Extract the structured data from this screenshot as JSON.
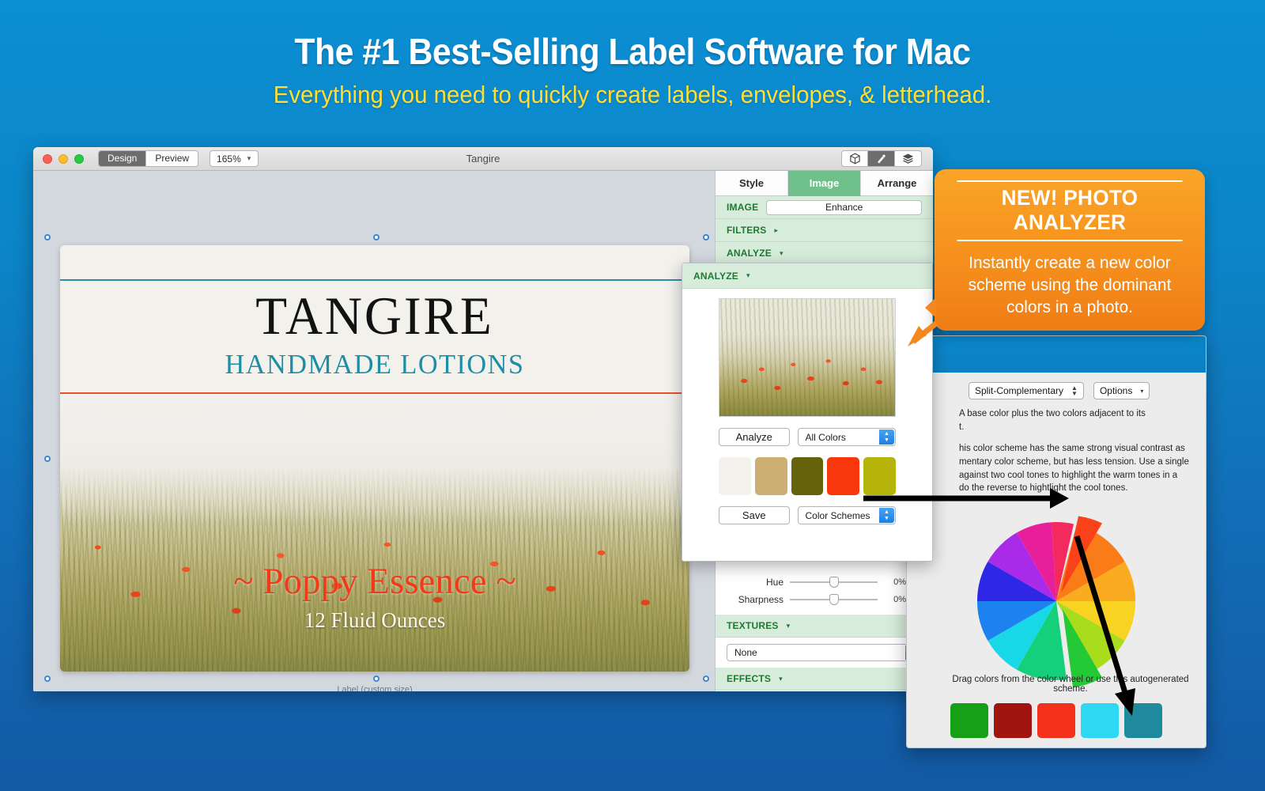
{
  "promo": {
    "title": "The #1 Best-Selling Label Software for Mac",
    "subtitle": "Everything you need to quickly create labels, envelopes, & letterhead.",
    "title_color": "#ffffff",
    "subtitle_color": "#ffdd33",
    "background_top": "#0b8ed2",
    "background_bottom": "#1359a4"
  },
  "window": {
    "title": "Tangire",
    "view_modes": {
      "design": "Design",
      "preview": "Preview",
      "active": "Design"
    },
    "zoom": {
      "value": "165%",
      "caret": "chevron-down-icon"
    },
    "toolbar_icons": [
      {
        "name": "box-icon",
        "active": false
      },
      {
        "name": "paint-inspector-icon",
        "active": true
      },
      {
        "name": "layers-icon",
        "active": false
      }
    ],
    "status": "Label (custom size)"
  },
  "label": {
    "brand": "TANGIRE",
    "brand_color": "#121212",
    "tagline": "HANDMADE LOTIONS",
    "tagline_color": "#1d8ea6",
    "rule_top_color": "#2b8fa3",
    "rule_bottom_color": "#e8502a",
    "flavor": "~ Poppy Essence ~",
    "flavor_color": "#f03a18",
    "volume": "12 Fluid Ounces",
    "volume_color": "#fbf8f0"
  },
  "inspector": {
    "tabs": [
      {
        "label": "Style",
        "active": false
      },
      {
        "label": "Image",
        "active": true
      },
      {
        "label": "Arrange",
        "active": false
      }
    ],
    "accent": "#6fc08a",
    "header_bg": "#d7ecda",
    "header_text": "#1d7a30",
    "sections": {
      "image": {
        "title": "IMAGE",
        "button": "Enhance"
      },
      "filters": {
        "title": "FILTERS",
        "arrow": "▸"
      },
      "analyze": {
        "title": "ANALYZE",
        "arrow": "▾"
      },
      "textures": {
        "title": "TEXTURES",
        "arrow": "▾",
        "value": "None"
      },
      "effects": {
        "title": "EFFECTS",
        "arrow": "▾"
      }
    },
    "sliders": [
      {
        "label": "Hue",
        "value": "0%"
      },
      {
        "label": "Sharpness",
        "value": "0%"
      }
    ]
  },
  "analyze_popover": {
    "title": "ANALYZE",
    "arrow": "▾",
    "analyze_button": "Analyze",
    "filter_dropdown": "All Colors",
    "save_button": "Save",
    "schemes_dropdown": "Color Schemes",
    "swatches": [
      {
        "name": "off-white",
        "hex": "#f4f2ed"
      },
      {
        "name": "tan",
        "hex": "#cdae73"
      },
      {
        "name": "olive",
        "hex": "#64630c"
      },
      {
        "name": "orange-red",
        "hex": "#f8380c"
      },
      {
        "name": "yellow-olive",
        "hex": "#b6b40a"
      }
    ]
  },
  "callout": {
    "title": "NEW! PHOTO ANALYZER",
    "body": "Instantly create a new color scheme using the dominant colors in a photo.",
    "bg_top": "#f9a528",
    "bg_bottom": "#f07d15"
  },
  "color_scheme_window": {
    "scheme_type": "Split-Complementary",
    "options_label": "Options",
    "description_1": "A base color plus the two colors adjacent to its",
    "description_1b": "t.",
    "description_2": "his color scheme has the same strong visual contrast as",
    "description_2b": "mentary color scheme, but has less tension. Use a single",
    "description_2c": "against two cool tones to highlight the warm tones in a",
    "description_2d": "do the reverse to hightlight the cool tones.",
    "caption": "Drag colors from the color wheel or use this autogenerated scheme.",
    "wheel_segments": [
      "#f9421a",
      "#f97c18",
      "#fba51c",
      "#f9d321",
      "#b9e01e",
      "#5ed21a",
      "#17c93f",
      "#16d08e",
      "#19d6e0",
      "#1b7ef0",
      "#3a2ae8",
      "#9b2ae8",
      "#e81f9b",
      "#f62a55"
    ],
    "swatches": [
      {
        "name": "green",
        "hex": "#17a017"
      },
      {
        "name": "dark-red",
        "hex": "#a01510"
      },
      {
        "name": "red",
        "hex": "#f5301c"
      },
      {
        "name": "cyan",
        "hex": "#2fd8f2"
      },
      {
        "name": "teal",
        "hex": "#1f8a9e"
      }
    ]
  }
}
